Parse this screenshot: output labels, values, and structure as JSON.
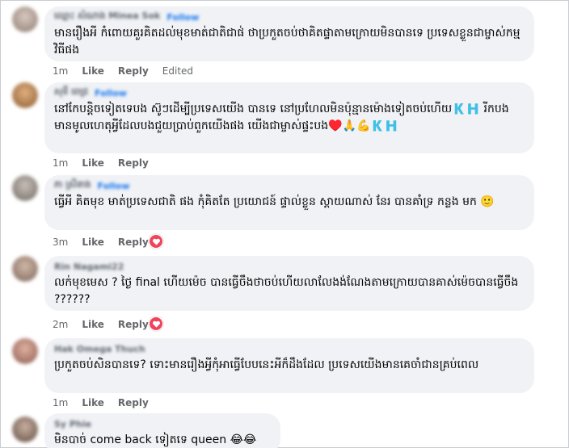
{
  "labels": {
    "like": "Like",
    "reply": "Reply",
    "follow": "Follow"
  },
  "comments": [
    {
      "author": "ឈ្មោះ សំណាង Minea Sok",
      "show_follow": true,
      "text": "មានរឿងអី កំពោយគួរគិតដល់មុខមាត់ជាតិជាផ់ ថាប្រកួតចប់ថាគិតផ្ទាតាមក្រោយមិនបានទេ ប្រទេសខ្លួនជាម្ចាស់កម្មវិធីផង",
      "time": "1m",
      "edited": "Edited",
      "avatar_color": "#b7a39a"
    },
    {
      "author": "សុខី ពេជ្រ",
      "show_follow": true,
      "text": "នៅកែបន្តិចទៀតទេបង ស៊ូៗដើម្បីប្រទេសយើង បានទេ នៅប្រហែលមិនប៉ុន្មានម៉ោងទៀតចប់ហើយ🇰🇭 រីកបងមានមូលហេតុអ្វីដែលបងជួយប្រាប់ពួកយើងផង យើងជាម្ចាស់ផ្ទះបង♥️🙏💪🇰🇭",
      "time": "1m",
      "avatar_color": "#c08a5a"
    },
    {
      "author": "ភា ស្រីនាង",
      "show_follow": true,
      "text": "ធ្វើអី គិតមុខ មាត់ប្រទេសជាតិ ផង កុំគិតតែ ប្រយោជន៍ ផ្ទាល់ខ្លួន ស្តាយណាស់ នែរ បានគាំទ្រ កន្លង មក 🙂",
      "time": "3m",
      "reaction": "love",
      "avatar_color": "#9a8f88"
    },
    {
      "author": "Rin Nagami22",
      "show_follow": false,
      "text": "លក់មុខមេស ? ថ្ងៃ final ហើយម៉េច បានធ្វើចឹងថាចប់ហើយលាលែងង់ណែងតាមក្រោយបានគាស់ម៉េចបានធ្វើចឹង ??????",
      "time": "2m",
      "reaction": "love",
      "avatar_color": "#a89488"
    },
    {
      "author": "Hak Omega Thuch",
      "show_follow": false,
      "text": "ប្រកួតចប់សិនបានទេ? ទោះមានរឿងអ្វីកុំអាធ្វើបែបនេះអីក៏ដឹងដែល ប្រទេសយើងមានគេចាំជានគ្រប់ពេល",
      "time": "1m",
      "avatar_color": "#b4857a"
    },
    {
      "author": "Sy Phie",
      "show_follow": false,
      "text": "មិនបាច់ come back ទៀតទេ queen 😂😂",
      "avatar_color": "#8f7a70"
    }
  ]
}
